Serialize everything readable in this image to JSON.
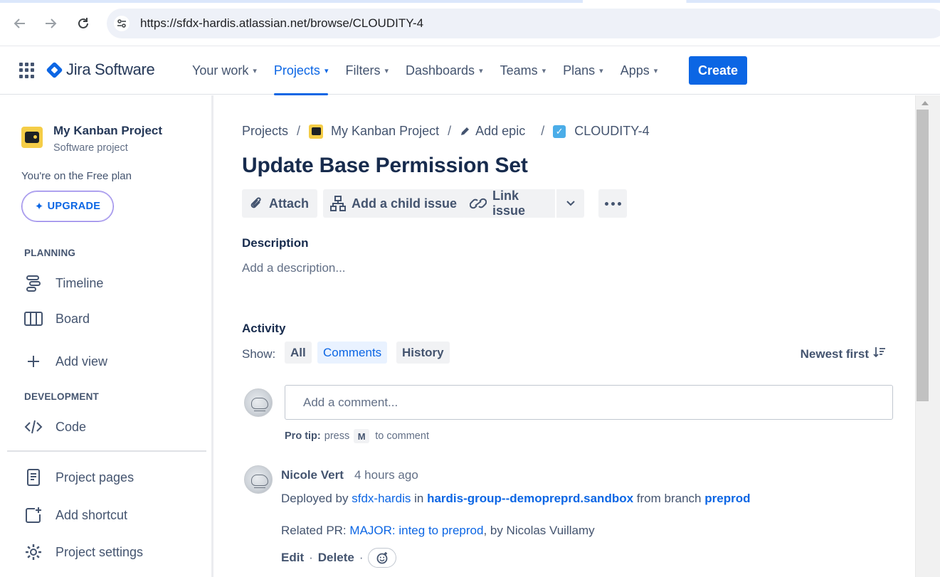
{
  "browser": {
    "url": "https://sfdx-hardis.atlassian.net/browse/CLOUDITY-4"
  },
  "header": {
    "product_name": "Jira Software",
    "nav": [
      {
        "label": "Your work"
      },
      {
        "label": "Projects"
      },
      {
        "label": "Filters"
      },
      {
        "label": "Dashboards"
      },
      {
        "label": "Teams"
      },
      {
        "label": "Plans"
      },
      {
        "label": "Apps"
      }
    ],
    "active_nav": "Projects",
    "create_label": "Create",
    "brand_color": "#0c66e4"
  },
  "sidebar": {
    "project_name": "My Kanban Project",
    "project_type": "Software project",
    "plan_text": "You're on the Free plan",
    "upgrade_label": "UPGRADE",
    "planning_heading": "PLANNING",
    "planning_items": [
      {
        "label": "Timeline",
        "icon": "timeline-icon"
      },
      {
        "label": "Board",
        "icon": "board-icon"
      }
    ],
    "add_view_label": "Add view",
    "development_heading": "DEVELOPMENT",
    "development_items": [
      {
        "label": "Code",
        "icon": "code-icon"
      }
    ],
    "footer_items": [
      {
        "label": "Project pages",
        "icon": "page-icon"
      },
      {
        "label": "Add shortcut",
        "icon": "add-shortcut-icon"
      },
      {
        "label": "Project settings",
        "icon": "gear-icon"
      }
    ]
  },
  "issue": {
    "breadcrumb": {
      "projects": "Projects",
      "project": "My Kanban Project",
      "epic": "Add epic",
      "key": "CLOUDITY-4"
    },
    "title": "Update Base Permission Set",
    "actions": {
      "attach": "Attach",
      "add_child": "Add a child issue",
      "link_issue": "Link issue"
    },
    "description_label": "Description",
    "description_placeholder": "Add a description..."
  },
  "activity": {
    "label": "Activity",
    "show_label": "Show:",
    "filters": [
      "All",
      "Comments",
      "History"
    ],
    "active_filter": "Comments",
    "sort_label": "Newest first",
    "comment_placeholder": "Add a comment...",
    "protip_bold": "Pro tip:",
    "protip_press": "press",
    "protip_key": "M",
    "protip_rest": "to comment"
  },
  "comment": {
    "author": "Nicole Vert",
    "time": "4 hours ago",
    "deployed_by": "Deployed by",
    "actor_link": "sfdx-hardis",
    "in_text": "in",
    "org_link": "hardis-group--demopreprd.sandbox",
    "from_branch": "from branch",
    "branch_link": "preprod",
    "related_pr": "Related PR:",
    "pr_link": "MAJOR: integ to preprod",
    "pr_by": ", by Nicolas Vuillamy",
    "edit": "Edit",
    "delete": "Delete",
    "dot": "·"
  }
}
